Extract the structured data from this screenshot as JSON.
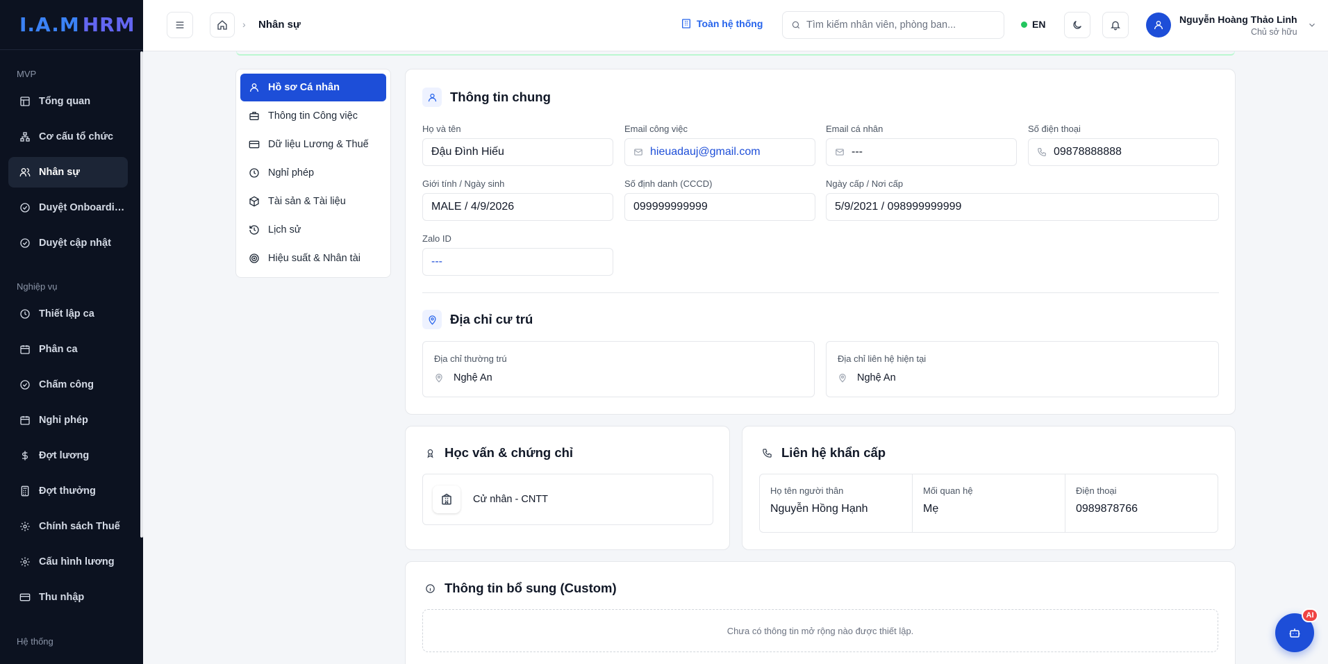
{
  "app": {
    "logo_main": "I.A.M",
    "logo_sub": "HRM"
  },
  "sidebar": {
    "groups": [
      "MVP",
      "Nghiệp vụ",
      "Hệ thống"
    ],
    "items": [
      {
        "label": "Tổng quan",
        "icon": "dashboard-icon"
      },
      {
        "label": "Cơ cấu tổ chức",
        "icon": "hierarchy-icon"
      },
      {
        "label": "Nhân sự",
        "icon": "users-icon",
        "active": true
      },
      {
        "label": "Duyệt Onboarding",
        "icon": "check-circle-icon"
      },
      {
        "label": "Duyệt cập nhật",
        "icon": "check-circle-icon"
      },
      {
        "label": "Thiết lập ca",
        "icon": "clock-icon"
      },
      {
        "label": "Phân ca",
        "icon": "calendar-icon"
      },
      {
        "label": "Chấm công",
        "icon": "check-circle-icon"
      },
      {
        "label": "Nghỉ phép",
        "icon": "calendar-icon"
      },
      {
        "label": "Đợt lương",
        "icon": "dollar-icon"
      },
      {
        "label": "Đợt thưởng",
        "icon": "calculator-icon"
      },
      {
        "label": "Chính sách Thuế",
        "icon": "gear-icon"
      },
      {
        "label": "Cấu hình lương",
        "icon": "gear-icon"
      },
      {
        "label": "Thu nhập",
        "icon": "card-icon"
      }
    ]
  },
  "header": {
    "breadcrumb": "Nhân sự",
    "scope": "Toàn hệ thống",
    "search_placeholder": "Tìm kiếm nhân viên, phòng ban...",
    "lang": "EN",
    "user_name": "Nguyễn Hoàng Thảo Linh",
    "user_role": "Chủ sở hữu"
  },
  "tabs": [
    {
      "label": "Hồ sơ Cá nhân",
      "icon": "user-icon",
      "active": true
    },
    {
      "label": "Thông tin Công việc",
      "icon": "briefcase-icon"
    },
    {
      "label": "Dữ liệu Lương & Thuế",
      "icon": "card-icon"
    },
    {
      "label": "Nghỉ phép",
      "icon": "clock-icon"
    },
    {
      "label": "Tài sản & Tài liệu",
      "icon": "box-icon"
    },
    {
      "label": "Lịch sử",
      "icon": "history-icon"
    },
    {
      "label": "Hiệu suất & Nhân tài",
      "icon": "target-icon"
    }
  ],
  "general": {
    "title": "Thông tin chung",
    "fields": {
      "full_name": {
        "label": "Họ và tên",
        "value": "Đậu Đình Hiếu"
      },
      "work_email": {
        "label": "Email công việc",
        "value": "hieuadauj@gmail.com"
      },
      "personal_email": {
        "label": "Email cá nhân",
        "value": "---"
      },
      "phone": {
        "label": "Số điện thoại",
        "value": "09878888888"
      },
      "gender_dob": {
        "label": "Giới tính / Ngày sinh",
        "value": "MALE / 4/9/2026"
      },
      "id_number": {
        "label": "Số định danh (CCCD)",
        "value": "099999999999"
      },
      "issue": {
        "label": "Ngày cấp / Nơi cấp",
        "value": "5/9/2021 / 098999999999"
      },
      "zalo": {
        "label": "Zalo ID",
        "value": "---"
      }
    }
  },
  "address": {
    "title": "Địa chỉ cư trú",
    "permanent_label": "Địa chỉ thường trú",
    "permanent_value": "Nghệ An",
    "current_label": "Địa chỉ liên hệ hiện tại",
    "current_value": "Nghệ An"
  },
  "education": {
    "title": "Học vấn & chứng chỉ",
    "item": "Cử nhân - CNTT"
  },
  "emergency": {
    "title": "Liên hệ khẩn cấp",
    "name_label": "Họ tên người thân",
    "name_value": "Nguyễn Hồng Hạnh",
    "relation_label": "Mối quan hệ",
    "relation_value": "Mẹ",
    "phone_label": "Điện thoại",
    "phone_value": "0989878766"
  },
  "custom": {
    "title": "Thông tin bổ sung (Custom)",
    "empty": "Chưa có thông tin mở rộng nào được thiết lập."
  },
  "fab": {
    "badge": "AI"
  },
  "colors": {
    "accent": "#1d4ed8",
    "sidebar_bg": "#0c1220",
    "status_online": "#22c55e",
    "badge": "#ef4444"
  }
}
